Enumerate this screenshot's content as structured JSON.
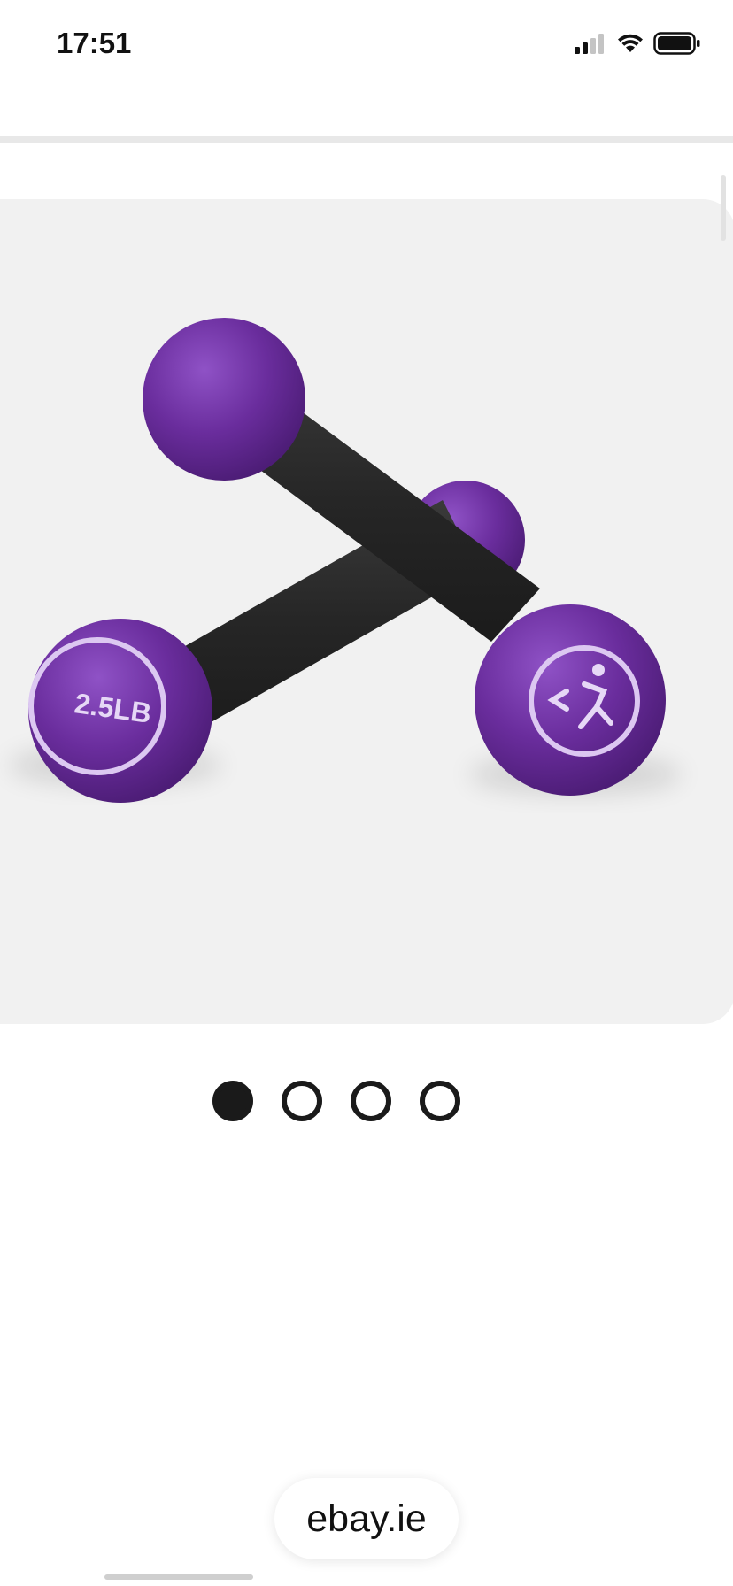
{
  "status_bar": {
    "time": "17:51",
    "icons": [
      "cellular-signal-icon",
      "wifi-icon",
      "battery-icon"
    ]
  },
  "product_image": {
    "weight_label": "2.5LB",
    "colors": {
      "background": "#f1f1f1",
      "bell": "#6b2e9e",
      "bell_highlight": "#8b4fc0",
      "bar": "#2b2b2b",
      "ring": "#d9c7ef"
    }
  },
  "pagination": {
    "total": 4,
    "active_index": 0
  },
  "browser": {
    "domain": "ebay.ie"
  }
}
